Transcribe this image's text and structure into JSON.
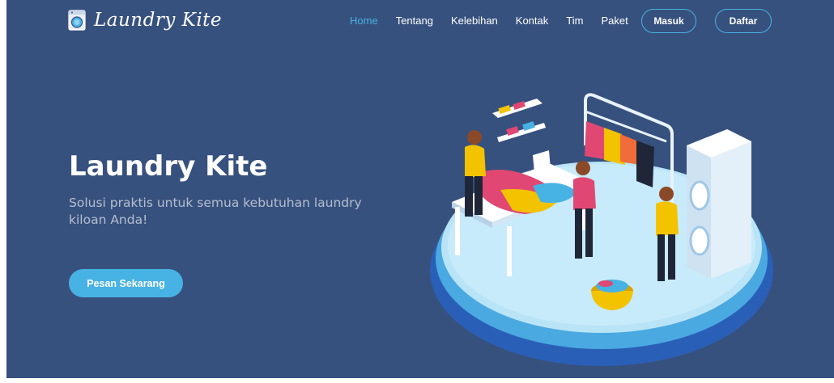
{
  "brand": {
    "name": "Laundry Kite",
    "icon": "washing-machine-icon"
  },
  "nav": {
    "items": [
      {
        "label": "Home",
        "active": true
      },
      {
        "label": "Tentang",
        "active": false
      },
      {
        "label": "Kelebihan",
        "active": false
      },
      {
        "label": "Kontak",
        "active": false
      },
      {
        "label": "Tim",
        "active": false
      },
      {
        "label": "Paket",
        "active": false
      }
    ],
    "login_label": "Masuk",
    "register_label": "Daftar"
  },
  "hero": {
    "title": "Laundry Kite",
    "subtitle": "Solusi praktis untuk semua kebutuhan laundry kiloan Anda!",
    "cta_label": "Pesan Sekarang",
    "illustration": "laundry-room-illustration"
  },
  "colors": {
    "background": "#37517e",
    "accent": "#47b2e4",
    "text": "#ffffff"
  }
}
